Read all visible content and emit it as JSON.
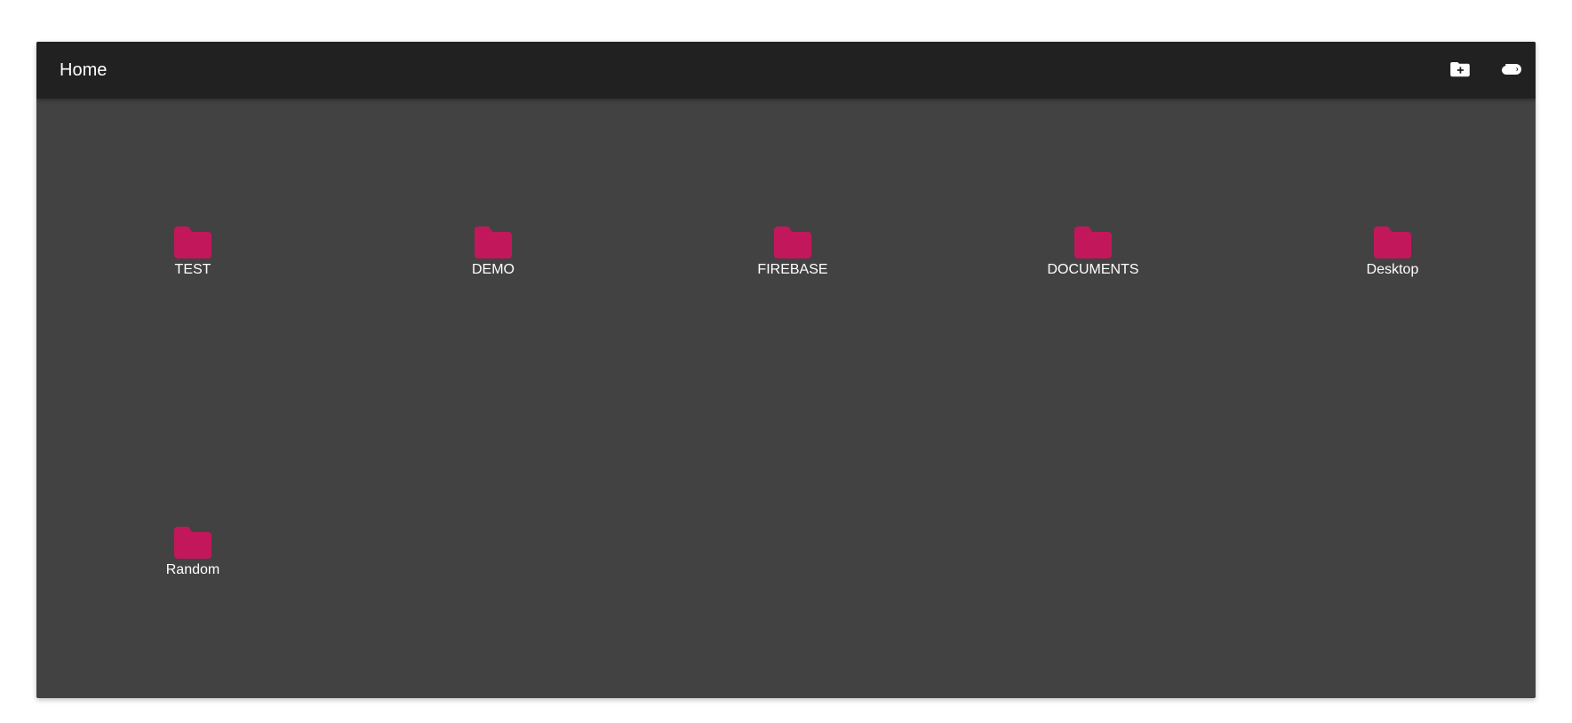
{
  "toolbar": {
    "title": "Home",
    "new_folder_icon": "create-new-folder-icon",
    "attach_icon": "attach-file-icon"
  },
  "folders": [
    {
      "label": "TEST",
      "icon": "folder-icon"
    },
    {
      "label": "DEMO",
      "icon": "folder-icon"
    },
    {
      "label": "FIREBASE",
      "icon": "folder-icon"
    },
    {
      "label": "DOCUMENTS",
      "icon": "folder-icon"
    },
    {
      "label": "Desktop",
      "icon": "folder-icon"
    },
    {
      "label": "Random",
      "icon": "folder-icon"
    }
  ],
  "colors": {
    "toolbar_bg": "#212121",
    "content_bg": "#424242",
    "folder_accent": "#c2185b",
    "text": "#ffffff"
  }
}
